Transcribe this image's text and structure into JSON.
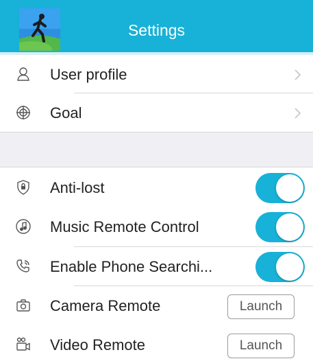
{
  "header": {
    "title": "Settings",
    "logo_icon": "running-man-logo",
    "accent_color": "#18b1d7"
  },
  "settings": {
    "user_profile_label": "User profile",
    "goal_label": "Goal",
    "anti_lost_label": "Anti-lost",
    "anti_lost_on": true,
    "music_remote_label": "Music Remote Control",
    "music_remote_on": true,
    "phone_search_label": "Enable Phone Searchi...",
    "phone_search_on": true,
    "camera_remote_label": "Camera Remote",
    "camera_launch_label": "Launch",
    "video_remote_label": "Video Remote",
    "video_launch_label": "Launch"
  },
  "icons": {
    "user_profile": "user-icon",
    "goal": "target-icon",
    "anti_lost": "lock-shield-icon",
    "music": "music-note-icon",
    "phone": "phone-ring-icon",
    "camera": "camera-icon",
    "video": "video-camera-icon",
    "chevron": "chevron-right-icon"
  }
}
